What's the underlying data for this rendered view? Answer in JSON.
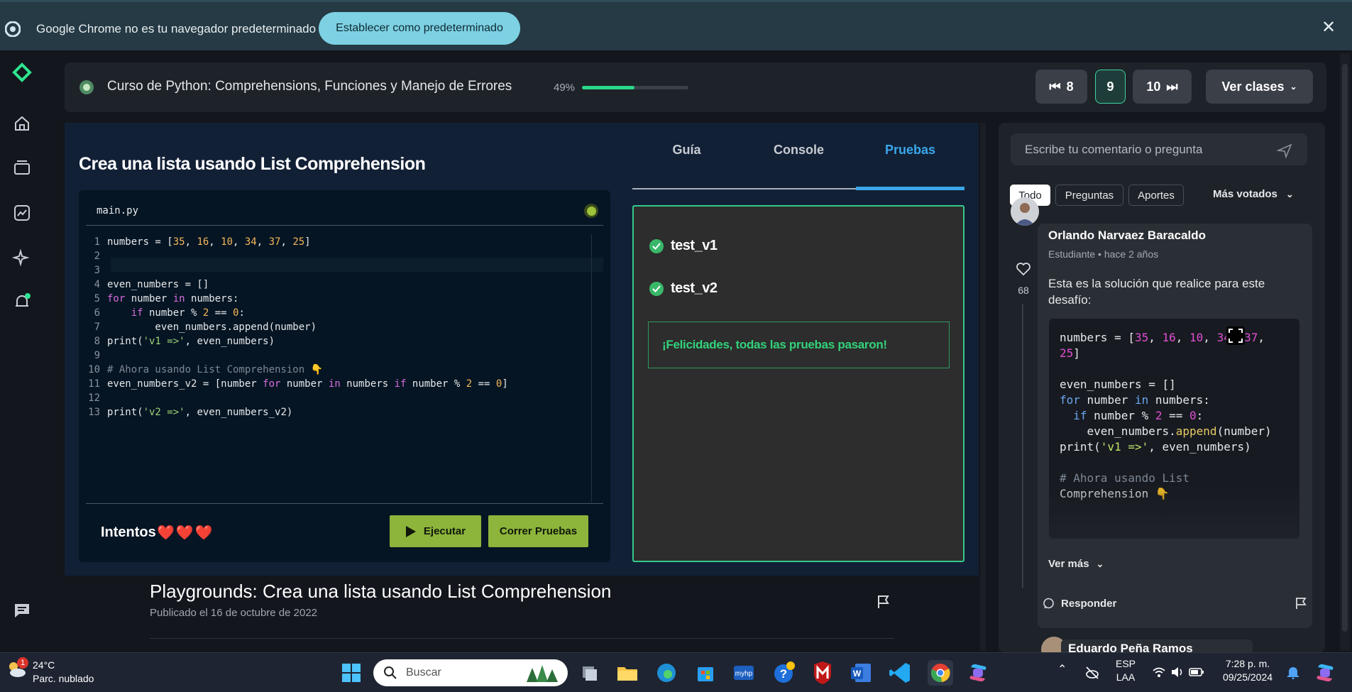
{
  "infobar": {
    "message": "Google Chrome no es tu navegador predeterminado",
    "set_default_label": "Establecer como predeterminado"
  },
  "course": {
    "title": "Curso de Python: Comprehensions, Funciones y Manejo de Errores",
    "progress_label": "49%",
    "progress": 0.49,
    "prev_label": "8",
    "current_label": "9",
    "next_label": "10",
    "classes_label": "Ver clases"
  },
  "exercise": {
    "title": "Crea una lista usando List Comprehension",
    "file_name": "main.py",
    "code_lines": [
      {
        "n": "1",
        "t": "numbers = [35, 16, 10, 34, 37, 25]"
      },
      {
        "n": "2",
        "t": ""
      },
      {
        "n": "3",
        "t": ""
      },
      {
        "n": "4",
        "t": "even_numbers = []"
      },
      {
        "n": "5",
        "t": "for number in numbers:"
      },
      {
        "n": "6",
        "t": "    if number % 2 == 0:"
      },
      {
        "n": "7",
        "t": "        even_numbers.append(number)"
      },
      {
        "n": "8",
        "t": "print('v1 =>', even_numbers)"
      },
      {
        "n": "9",
        "t": ""
      },
      {
        "n": "10",
        "t": "# Ahora usando List Comprehension 👇"
      },
      {
        "n": "11",
        "t": "even_numbers_v2 = [number for number in numbers if number % 2 == 0]"
      },
      {
        "n": "12",
        "t": ""
      },
      {
        "n": "13",
        "t": "print('v2 =>', even_numbers_v2)"
      }
    ],
    "attempts_label": "Intentos",
    "hearts": "❤️❤️❤️",
    "run_label": "Ejecutar",
    "test_label": "Correr Pruebas",
    "tabs": [
      "Guía",
      "Console",
      "Pruebas"
    ],
    "tests": [
      "test_v1",
      "test_v2"
    ],
    "success_message": "¡Felicidades, todas las pruebas pasaron!"
  },
  "playground": {
    "title": "Playgrounds: Crea una lista usando List Comprehension",
    "date": "Publicado el 16 de octubre de 2022"
  },
  "comments": {
    "placeholder": "Escribe tu comentario o pregunta",
    "filters": [
      "Todo",
      "Preguntas",
      "Aportes"
    ],
    "sort_label": "Más votados",
    "author": "Orlando Narvaez Baracaldo",
    "author_meta": "Estudiante • hace 2 años",
    "likes": "68",
    "text": "Esta es la solución que realice para este desafío:",
    "snippet_lines": [
      "numbers = [35, 16, 10, 34, 37,",
      "25]",
      "",
      "even_numbers = []",
      "for number in numbers:",
      "  if number % 2 == 0:",
      "    even_numbers.append(number)",
      "print('v1 =>', even_numbers)",
      "",
      "# Ahora usando List",
      "Comprehension 👇"
    ],
    "see_more_label": "Ver más",
    "reply_label": "Responder",
    "next_author": "Eduardo Peña Ramos"
  },
  "taskbar": {
    "weather_badge": "1",
    "temperature": "24°C",
    "weather_desc": "Parc. nublado",
    "search_placeholder": "Buscar",
    "lang_top": "ESP",
    "lang_bottom": "LAA",
    "time": "7:28 p. m.",
    "date": "09/25/2024"
  },
  "colors": {
    "accent_green": "#29d88a",
    "run_button": "#8db43b",
    "tests_border": "#36c98b",
    "active_tab": "#3aa7ea"
  }
}
